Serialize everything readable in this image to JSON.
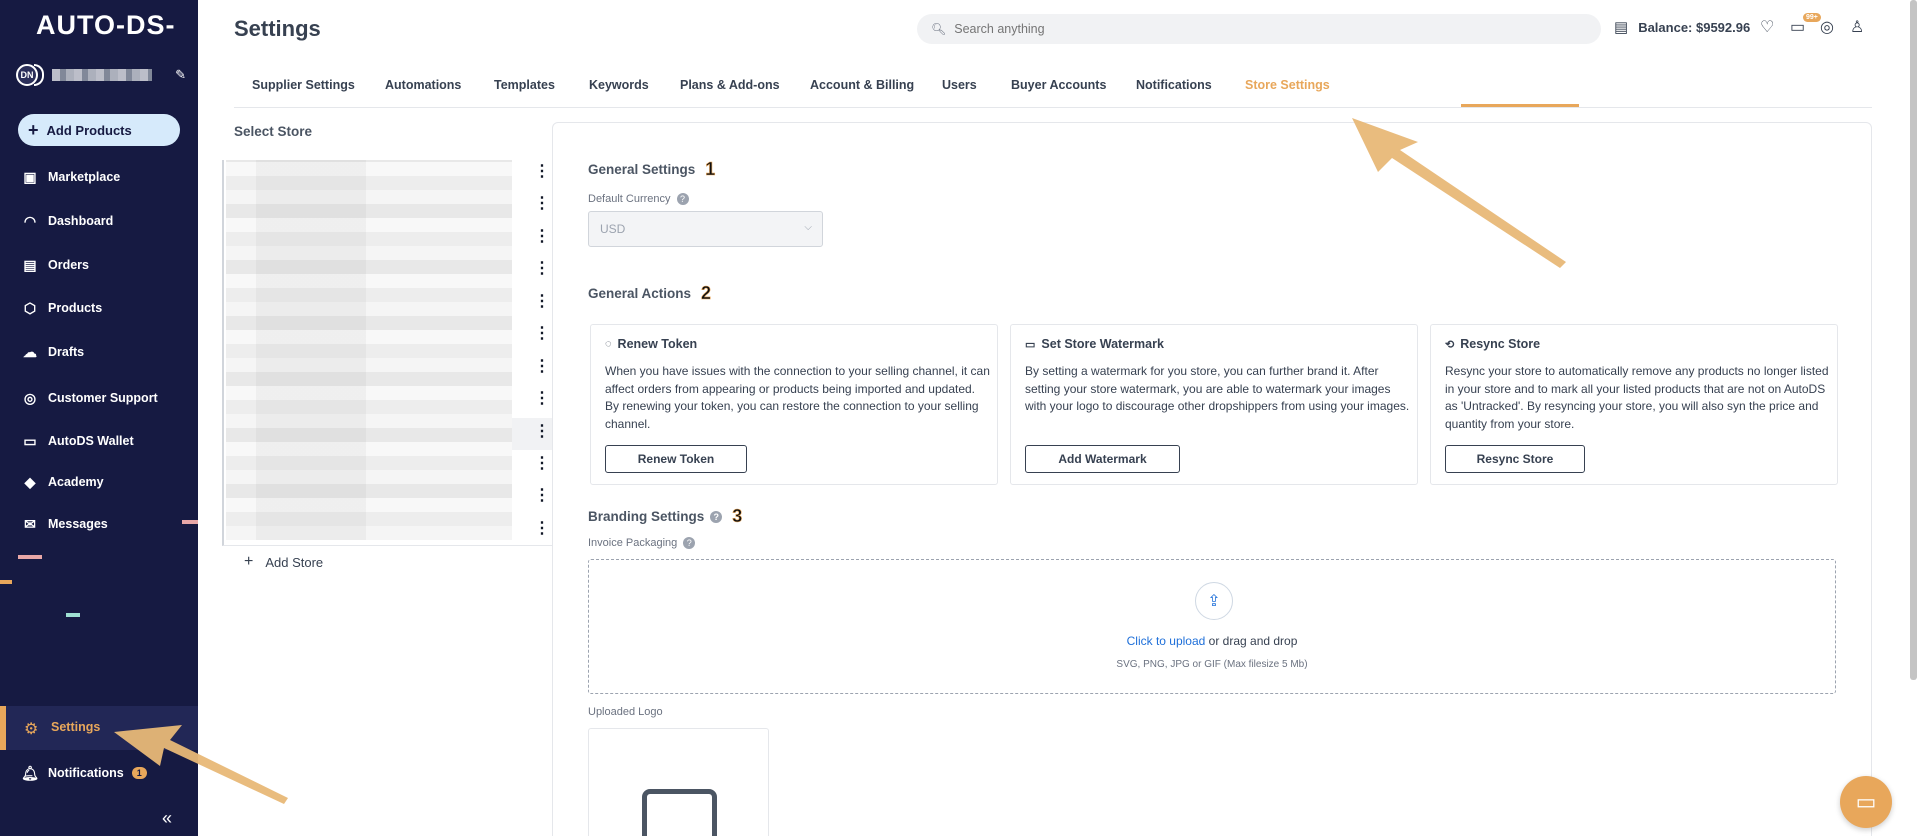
{
  "sidebar": {
    "logo": "AUTO-DS-",
    "avatar_initials": "DN",
    "add_products_label": "Add Products",
    "items": [
      {
        "label": "Marketplace",
        "icon": "store-icon"
      },
      {
        "label": "Dashboard",
        "icon": "gauge-icon"
      },
      {
        "label": "Orders",
        "icon": "clipboard-icon"
      },
      {
        "label": "Products",
        "icon": "box-icon"
      },
      {
        "label": "Drafts",
        "icon": "cloud-upload-icon"
      },
      {
        "label": "Customer Support",
        "icon": "headset-icon"
      },
      {
        "label": "AutoDS Wallet",
        "icon": "wallet-icon"
      },
      {
        "label": "Academy",
        "icon": "graduation-cap-icon"
      },
      {
        "label": "Messages",
        "icon": "mail-icon"
      }
    ],
    "settings_label": "Settings",
    "notifications_label": "Notifications",
    "notifications_count": "1",
    "collapse_glyph": "«"
  },
  "header": {
    "title": "Settings",
    "search_placeholder": "Search anything",
    "balance": "Balance: $9592.96",
    "chat_badge": "99+"
  },
  "tabs": [
    {
      "label": "Supplier Settings",
      "active": false
    },
    {
      "label": "Automations",
      "active": false
    },
    {
      "label": "Templates",
      "active": false
    },
    {
      "label": "Keywords",
      "active": false
    },
    {
      "label": "Plans & Add-ons",
      "active": false
    },
    {
      "label": "Account & Billing",
      "active": false
    },
    {
      "label": "Users",
      "active": false
    },
    {
      "label": "Buyer Accounts",
      "active": false
    },
    {
      "label": "Notifications",
      "active": false
    },
    {
      "label": "Store Settings",
      "active": true
    }
  ],
  "stores": {
    "title": "Select Store",
    "add_store_label": "Add Store",
    "row_count_visible": 12,
    "active_row": 9
  },
  "general_settings": {
    "title": "General Settings",
    "step": "1",
    "currency_label": "Default Currency",
    "currency_value": "USD"
  },
  "general_actions": {
    "title": "General Actions",
    "step": "2",
    "cards": [
      {
        "title": "Renew Token",
        "icon": "refresh-icon",
        "description": "When you have issues with the connection to your selling channel, it can affect orders from appearing or products being imported and updated. By renewing your token, you can restore the connection to your selling channel.",
        "button": "Renew Token"
      },
      {
        "title": "Set Store Watermark",
        "icon": "image-icon",
        "description": "By setting a watermark for you store, you can further brand it. After setting your store watermark, you are able to watermark your images with your logo to discourage other dropshippers from using your images.",
        "button": "Add Watermark"
      },
      {
        "title": "Resync Store",
        "icon": "sync-icon",
        "description": "Resync your store to automatically remove any products no longer listed in your store and to mark all your listed products that are not on AutoDS as 'Untracked'. By resyncing your store, you will also syn the price and quantity from your store.",
        "button": "Resync Store"
      }
    ]
  },
  "branding": {
    "title": "Branding Settings",
    "step": "3",
    "invoice_label": "Invoice Packaging",
    "upload_link": "Click to upload",
    "upload_rest": " or drag and drop",
    "upload_hint": "SVG, PNG, JPG or GIF (Max filesize 5 Mb)",
    "uploaded_logo_label": "Uploaded Logo"
  },
  "colors": {
    "sidebar_bg": "#161a42",
    "accent": "#e8a75b",
    "link": "#1e6fd9"
  }
}
